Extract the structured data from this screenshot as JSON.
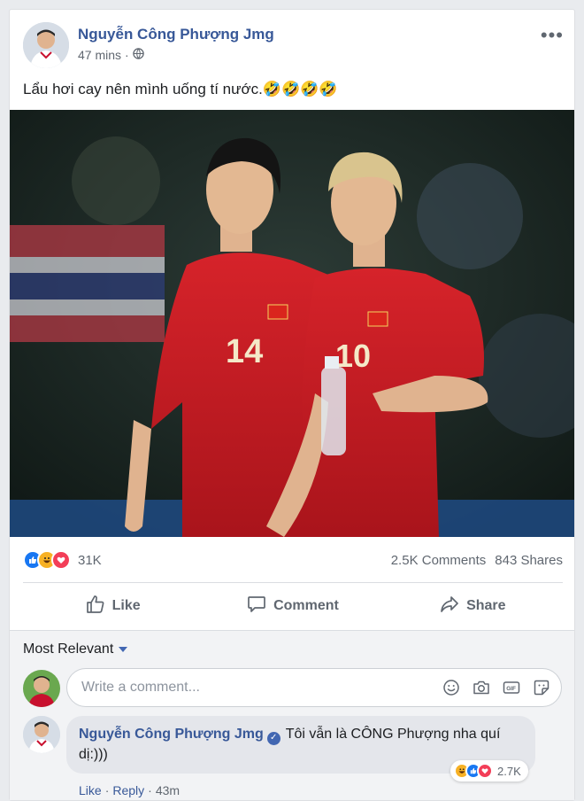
{
  "post": {
    "author": "Nguyễn Công Phượng Jmg",
    "time": "47 mins",
    "separator": "·",
    "text": "Lẩu hơi cay nên mình uống tí nước.🤣🤣🤣🤣",
    "more_icon": "•••"
  },
  "stats": {
    "reaction_count": "31K",
    "comments": "2.5K Comments",
    "shares": "843 Shares",
    "reaction_colors": {
      "like": "#1877f2",
      "haha": "#f7b125",
      "love": "#f33e58"
    }
  },
  "actions": {
    "like": "Like",
    "comment": "Comment",
    "share": "Share"
  },
  "comments": {
    "sort_label": "Most Relevant",
    "composer_placeholder": "Write a comment...",
    "items": [
      {
        "author": "Nguyễn Công Phượng Jmg",
        "text": "Tôi vẫn là CÔNG Phượng nha quí dị:)))",
        "reaction_count": "2.7K",
        "like": "Like",
        "reply": "Reply",
        "time": "43m",
        "separator": "·"
      }
    ]
  }
}
